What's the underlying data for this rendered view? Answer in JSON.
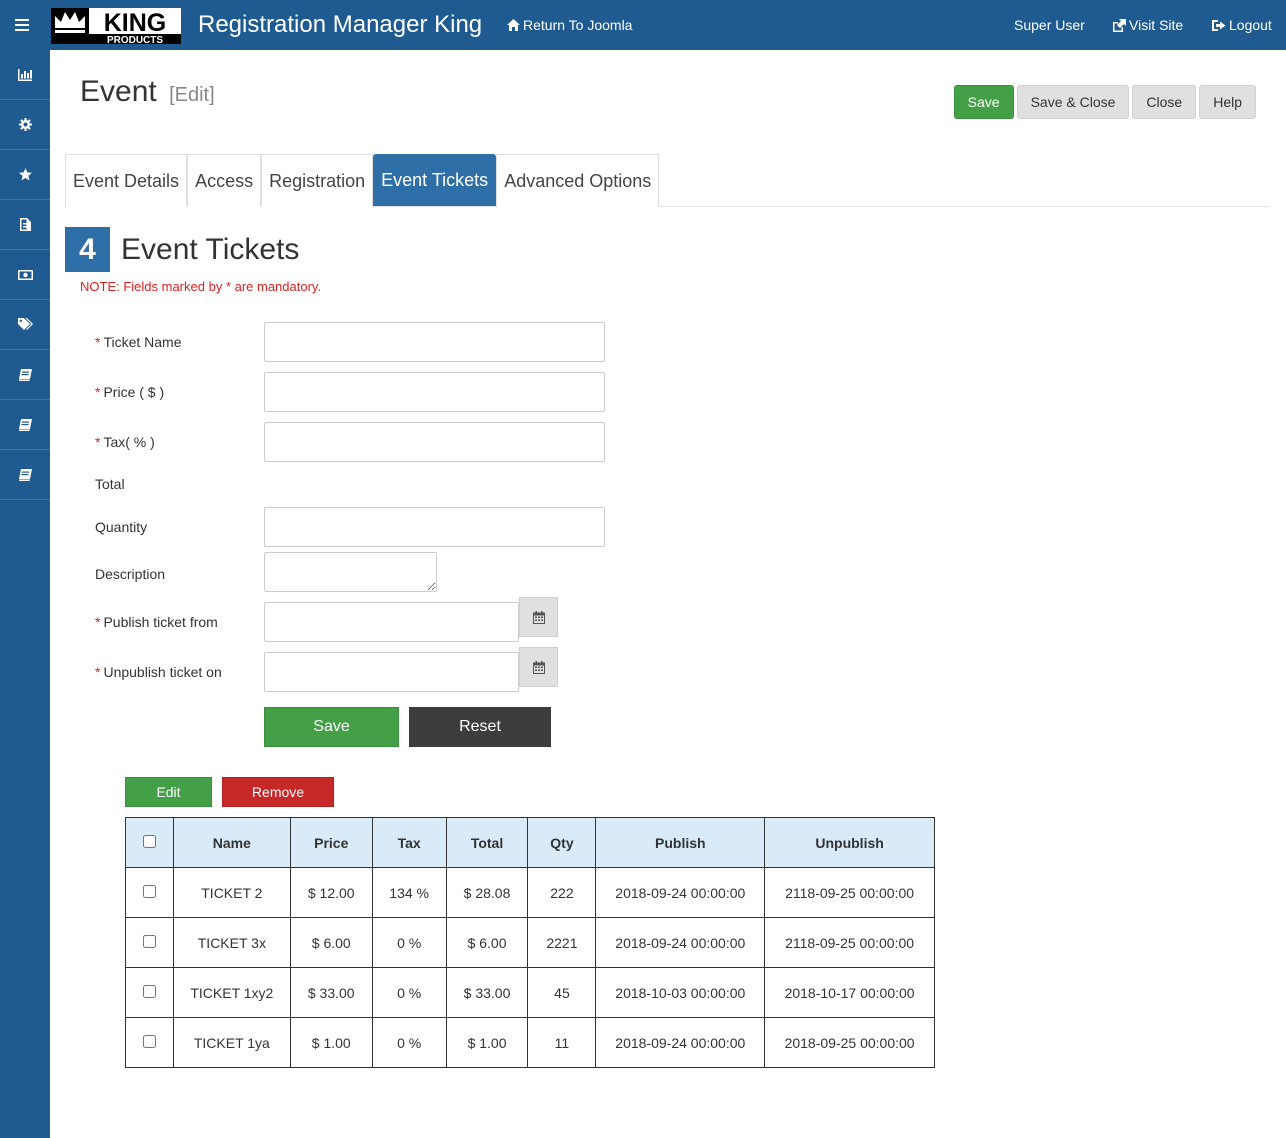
{
  "app": {
    "logo_main": "KING",
    "logo_sub": "PRODUCTS",
    "title": "Registration Manager King",
    "return_link": "Return To Joomla",
    "user": "Super User",
    "visit_site": "Visit Site",
    "logout": "Logout",
    "accent_color": "#1f5b90"
  },
  "sidebar": {
    "items": [
      "chart-icon",
      "gear-icon",
      "star-icon",
      "document-icon",
      "money-icon",
      "tags-icon",
      "book-icon",
      "book-icon",
      "book-icon"
    ]
  },
  "page": {
    "title": "Event",
    "subtitle": "[Edit]"
  },
  "toolbar": {
    "save": "Save",
    "save_close": "Save & Close",
    "close": "Close",
    "help": "Help"
  },
  "tabs": [
    {
      "label": "Event Details",
      "active": false
    },
    {
      "label": "Access",
      "active": false
    },
    {
      "label": "Registration",
      "active": false
    },
    {
      "label": "Event Tickets",
      "active": true
    },
    {
      "label": "Advanced Options",
      "active": false
    }
  ],
  "section": {
    "step": "4",
    "title": "Event Tickets",
    "note": "NOTE: Fields marked by * are mandatory."
  },
  "form": {
    "required_mark": "*",
    "ticket_name": "Ticket Name",
    "price": "Price ( $ )",
    "tax": "Tax( % )",
    "total": "Total",
    "quantity": "Quantity",
    "description": "Description",
    "publish_from": "Publish ticket from",
    "unpublish_on": "Unpublish ticket on",
    "save": "Save",
    "reset": "Reset"
  },
  "list_actions": {
    "edit": "Edit",
    "remove": "Remove"
  },
  "table": {
    "headers": [
      "Name",
      "Price",
      "Tax",
      "Total",
      "Qty",
      "Publish",
      "Unpublish"
    ],
    "rows": [
      [
        "TICKET 2",
        "$ 12.00",
        "134 %",
        "$ 28.08",
        "222",
        "2018-09-24 00:00:00",
        "2118-09-25 00:00:00"
      ],
      [
        "TICKET 3x",
        "$ 6.00",
        "0 %",
        "$ 6.00",
        "2221",
        "2018-09-24 00:00:00",
        "2118-09-25 00:00:00"
      ],
      [
        "TICKET 1xy2",
        "$ 33.00",
        "0 %",
        "$ 33.00",
        "45",
        "2018-10-03 00:00:00",
        "2018-10-17 00:00:00"
      ],
      [
        "TICKET 1ya",
        "$ 1.00",
        "0 %",
        "$ 1.00",
        "11",
        "2018-09-24 00:00:00",
        "2018-09-25 00:00:00"
      ]
    ]
  }
}
